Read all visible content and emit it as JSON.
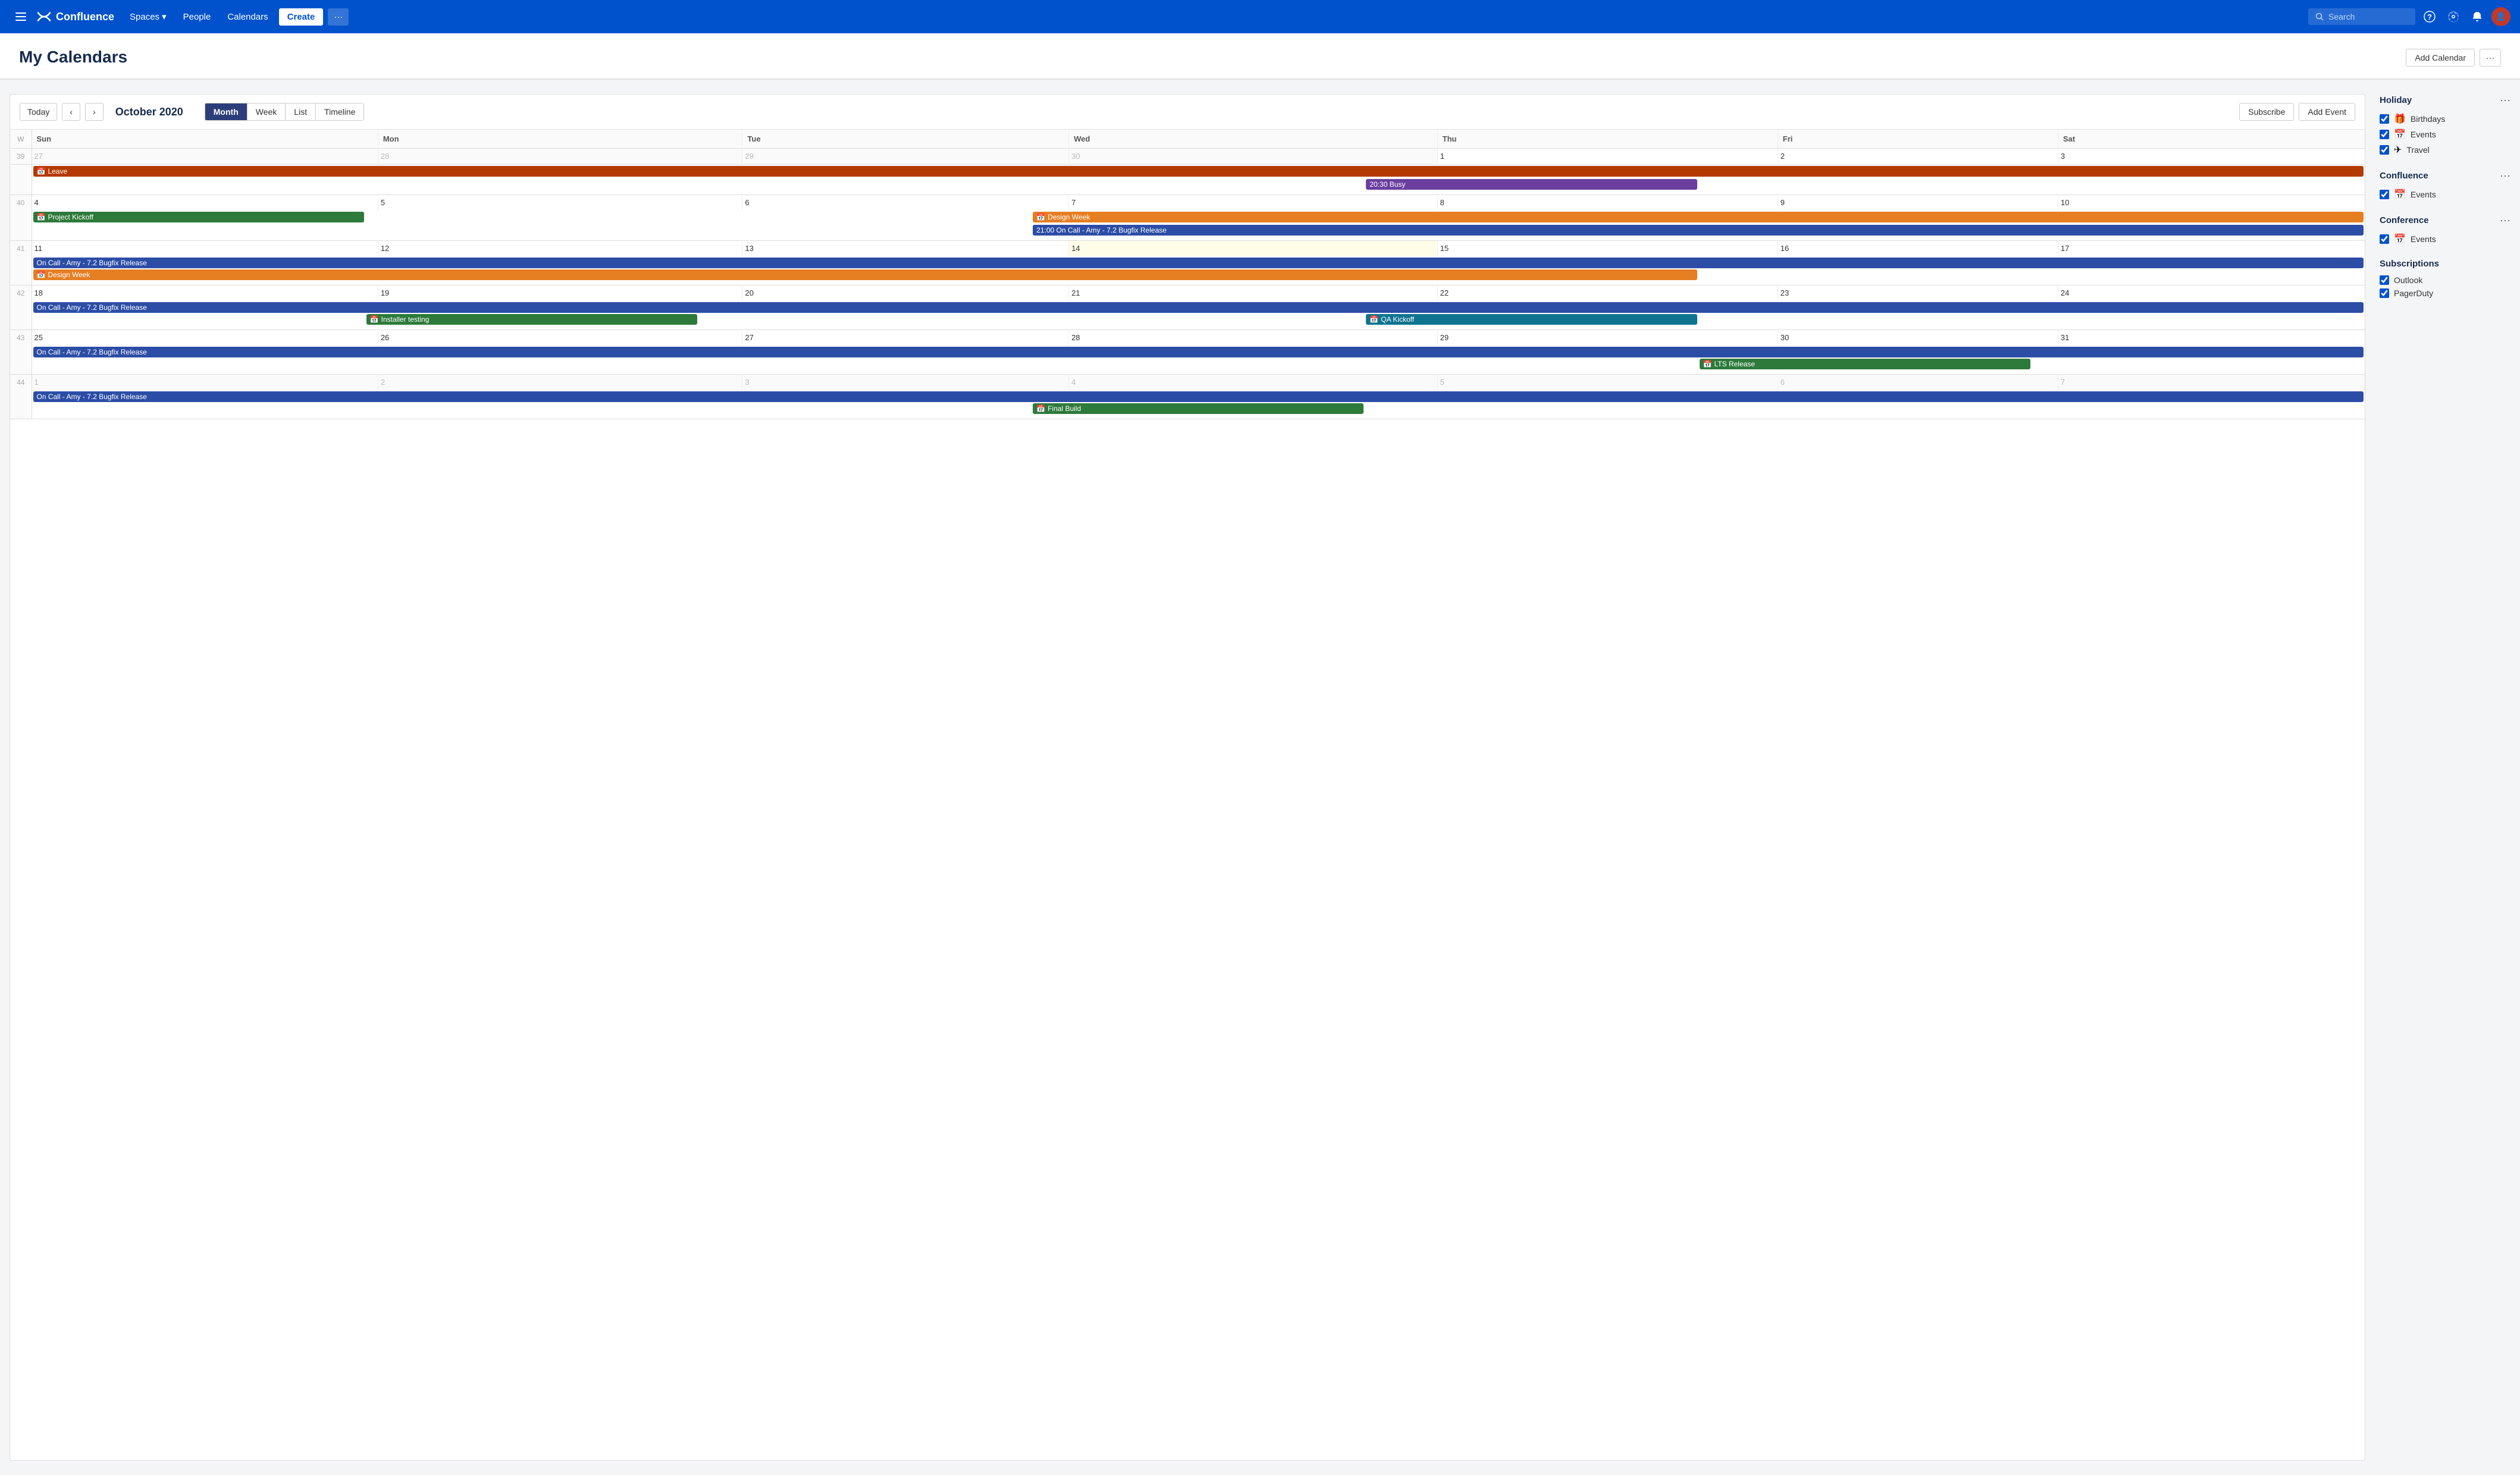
{
  "navbar": {
    "brand": "Confluence",
    "spaces_label": "Spaces",
    "people_label": "People",
    "calendars_label": "Calendars",
    "create_label": "Create",
    "more_label": "···",
    "search_placeholder": "Search",
    "help_label": "?",
    "settings_label": "⚙",
    "notifications_label": "🔔"
  },
  "page": {
    "title": "My Calendars",
    "add_calendar_label": "Add Calendar",
    "more_label": "···"
  },
  "calendar": {
    "today_label": "Today",
    "prev_label": "‹",
    "next_label": "›",
    "month_year": "October 2020",
    "views": [
      "Month",
      "Week",
      "List",
      "Timeline"
    ],
    "active_view": "Month",
    "subscribe_label": "Subscribe",
    "add_event_label": "Add Event",
    "headers": [
      "W",
      "Sun",
      "Mon",
      "Tue",
      "Wed",
      "Thu",
      "Fri",
      "Sat"
    ],
    "weeks": [
      {
        "week_num": "39",
        "days": [
          {
            "num": "27",
            "other": true
          },
          {
            "num": "28",
            "other": true
          },
          {
            "num": "29",
            "other": true
          },
          {
            "num": "30",
            "other": true
          },
          {
            "num": "1"
          },
          {
            "num": "2"
          },
          {
            "num": "3"
          }
        ],
        "events": [
          {
            "label": "Leave",
            "color": "red",
            "icon": "📅",
            "col_start": 1,
            "col_span": 7
          },
          {
            "label": "20:30 Busy",
            "color": "purple",
            "col_start": 5,
            "col_span": 1
          }
        ]
      },
      {
        "week_num": "40",
        "days": [
          {
            "num": "4"
          },
          {
            "num": "5"
          },
          {
            "num": "6"
          },
          {
            "num": "7"
          },
          {
            "num": "8"
          },
          {
            "num": "9"
          },
          {
            "num": "10"
          }
        ],
        "events": [
          {
            "label": "Project Kickoff",
            "color": "green",
            "icon": "📅",
            "col_start": 1,
            "col_span": 1
          },
          {
            "label": "Design Week",
            "color": "orange",
            "icon": "📅",
            "col_start": 4,
            "col_span": 4
          },
          {
            "label": "21:00 On Call - Amy - 7.2 Bugfix Release",
            "color": "blue",
            "col_start": 4,
            "col_span": 4
          }
        ]
      },
      {
        "week_num": "41",
        "days": [
          {
            "num": "11"
          },
          {
            "num": "12"
          },
          {
            "num": "13"
          },
          {
            "num": "14",
            "today": true
          },
          {
            "num": "15"
          },
          {
            "num": "16"
          },
          {
            "num": "17"
          }
        ],
        "events": [
          {
            "label": "On Call - Amy - 7.2 Bugfix Release",
            "color": "blue",
            "col_start": 1,
            "col_span": 7
          },
          {
            "label": "Design Week",
            "color": "orange",
            "icon": "📅",
            "col_start": 1,
            "col_span": 5
          }
        ]
      },
      {
        "week_num": "42",
        "days": [
          {
            "num": "18"
          },
          {
            "num": "19"
          },
          {
            "num": "20"
          },
          {
            "num": "21"
          },
          {
            "num": "22"
          },
          {
            "num": "23"
          },
          {
            "num": "24"
          }
        ],
        "events": [
          {
            "label": "On Call - Amy - 7.2 Bugfix Release",
            "color": "blue",
            "col_start": 1,
            "col_span": 7
          },
          {
            "label": "Installer testing",
            "color": "green",
            "icon": "📅",
            "col_start": 2,
            "col_span": 1
          },
          {
            "label": "QA Kickoff",
            "color": "teal",
            "icon": "📅",
            "col_start": 5,
            "col_span": 1
          }
        ]
      },
      {
        "week_num": "43",
        "days": [
          {
            "num": "25"
          },
          {
            "num": "26"
          },
          {
            "num": "27"
          },
          {
            "num": "28"
          },
          {
            "num": "29"
          },
          {
            "num": "30"
          },
          {
            "num": "31"
          }
        ],
        "events": [
          {
            "label": "On Call - Amy - 7.2 Bugfix Release",
            "color": "blue",
            "col_start": 1,
            "col_span": 7
          },
          {
            "label": "LTS Release",
            "color": "green",
            "icon": "📅",
            "col_start": 6,
            "col_span": 1
          }
        ]
      },
      {
        "week_num": "44",
        "days": [
          {
            "num": "1",
            "other": true
          },
          {
            "num": "2",
            "other": true
          },
          {
            "num": "3",
            "other": true
          },
          {
            "num": "4",
            "other": true
          },
          {
            "num": "5",
            "other": true
          },
          {
            "num": "6",
            "other": true
          },
          {
            "num": "7",
            "other": true
          }
        ],
        "events": [
          {
            "label": "On Call - Amy - 7.2 Bugfix Release",
            "color": "blue",
            "col_start": 1,
            "col_span": 7
          },
          {
            "label": "Final Build",
            "color": "green",
            "icon": "📅",
            "col_start": 4,
            "col_span": 1
          }
        ]
      }
    ]
  },
  "sidebar": {
    "sections": [
      {
        "title": "Holiday",
        "items": [
          {
            "label": "Birthdays",
            "icon": "🎁",
            "checked": true,
            "color": "#e67e22"
          },
          {
            "label": "Events",
            "icon": "📅",
            "checked": true,
            "color": "#e74c3c"
          },
          {
            "label": "Travel",
            "icon": "✈",
            "checked": true,
            "color": "#f1c40f"
          }
        ]
      },
      {
        "title": "Confluence",
        "items": [
          {
            "label": "Events",
            "icon": "📅",
            "checked": true,
            "color": "#27ae60"
          }
        ]
      },
      {
        "title": "Conference",
        "items": [
          {
            "label": "Events",
            "icon": "📅",
            "checked": true,
            "color": "#e67e22"
          }
        ]
      },
      {
        "title": "Subscriptions",
        "items": [
          {
            "label": "Outlook",
            "checked": true
          },
          {
            "label": "PagerDuty",
            "checked": true
          }
        ]
      }
    ]
  }
}
